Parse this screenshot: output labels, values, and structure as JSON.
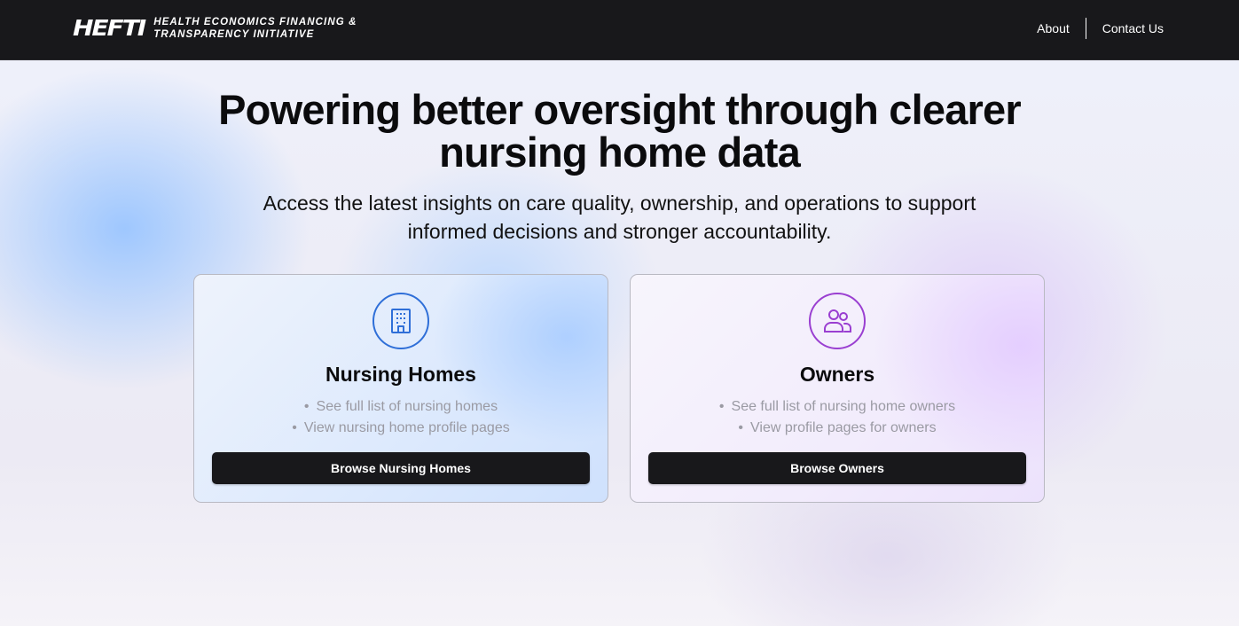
{
  "navbar": {
    "logo_mark": "HEFTI",
    "logo_line1": "HEALTH ECONOMICS FINANCING &",
    "logo_line2": "TRANSPARENCY INITIATIVE",
    "links": [
      "About",
      "Contact Us"
    ]
  },
  "hero": {
    "title_line1": "Powering better oversight through clearer",
    "title_line2": "nursing home data",
    "subtitle_line1": "Access the latest insights on care quality, ownership, and operations to support",
    "subtitle_line2": "informed decisions and stronger accountability."
  },
  "cards": [
    {
      "icon": "building-icon",
      "title": "Nursing Homes",
      "bullets": [
        "See full list of nursing homes",
        "View nursing home profile pages"
      ],
      "button": "Browse Nursing Homes",
      "accent": "#2f6fd8"
    },
    {
      "icon": "users-icon",
      "title": "Owners",
      "bullets": [
        "See full list of nursing home owners",
        "View profile pages for owners"
      ],
      "button": "Browse Owners",
      "accent": "#9a3fd1"
    }
  ]
}
